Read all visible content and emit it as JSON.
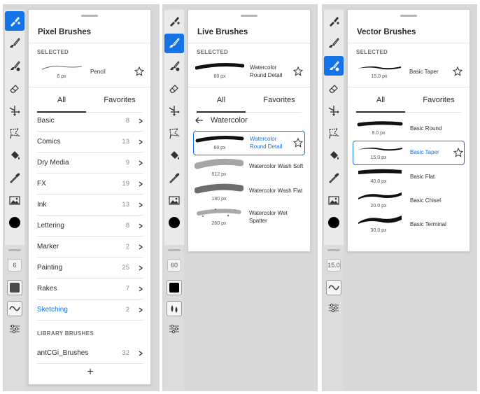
{
  "toolbar_icons": [
    "brush-add-icon",
    "brush-icon",
    "blend-brush-icon",
    "eraser-icon",
    "move-icon",
    "lasso-icon",
    "fill-icon",
    "eyedropper-icon",
    "image-icon",
    "color-swatch-icon"
  ],
  "colors": {
    "accent": "#1473e6",
    "text": "#2c2c2c",
    "muted": "#8a8a8a",
    "panel_bg": "#d8d8d8"
  },
  "panels": [
    {
      "title": "Pixel Brushes",
      "size_value": "6",
      "selected": {
        "label": "SELECTED",
        "px": "6 px",
        "name": "Pencil"
      },
      "tabs": [
        "All",
        "Favorites"
      ],
      "categories": [
        {
          "name": "Basic",
          "count": "8"
        },
        {
          "name": "Comics",
          "count": "13"
        },
        {
          "name": "Dry Media",
          "count": "9"
        },
        {
          "name": "FX",
          "count": "19"
        },
        {
          "name": "Ink",
          "count": "13"
        },
        {
          "name": "Lettering",
          "count": "8"
        },
        {
          "name": "Marker",
          "count": "2"
        },
        {
          "name": "Painting",
          "count": "25"
        },
        {
          "name": "Rakes",
          "count": "7"
        },
        {
          "name": "Sketching",
          "count": "2"
        }
      ],
      "library_label": "LIBRARY BRUSHES",
      "library": [
        {
          "name": "antCGi_Brushes",
          "count": "32"
        }
      ],
      "add_label": "+"
    },
    {
      "title": "Live Brushes",
      "size_value": "60",
      "selected": {
        "label": "SELECTED",
        "px": "60 px",
        "name_line1": "Watercolor",
        "name_line2": "Round Detail"
      },
      "tabs": [
        "All",
        "Favorites"
      ],
      "back_label": "Watercolor",
      "brushes": [
        {
          "px": "60 px",
          "name_line1": "Watercolor",
          "name_line2": "Round Detail"
        },
        {
          "px": "512 px",
          "name_line1": "Watercolor Wash Soft",
          "name_line2": ""
        },
        {
          "px": "180 px",
          "name_line1": "Watercolor Wash Flat",
          "name_line2": ""
        },
        {
          "px": "260 px",
          "name_line1": "Watercolor Wet",
          "name_line2": "Spatter"
        }
      ]
    },
    {
      "title": "Vector Brushes",
      "size_value": "15.0",
      "selected": {
        "label": "SELECTED",
        "px": "15.0 px",
        "name": "Basic Taper"
      },
      "tabs": [
        "All",
        "Favorites"
      ],
      "brushes": [
        {
          "px": "8.0 px",
          "name": "Basic Round"
        },
        {
          "px": "15.0 px",
          "name": "Basic Taper"
        },
        {
          "px": "40.0 px",
          "name": "Basic Flat"
        },
        {
          "px": "20.0 px",
          "name": "Basic Chisel"
        },
        {
          "px": "30.0 px",
          "name": "Basic Terminal"
        }
      ]
    }
  ]
}
